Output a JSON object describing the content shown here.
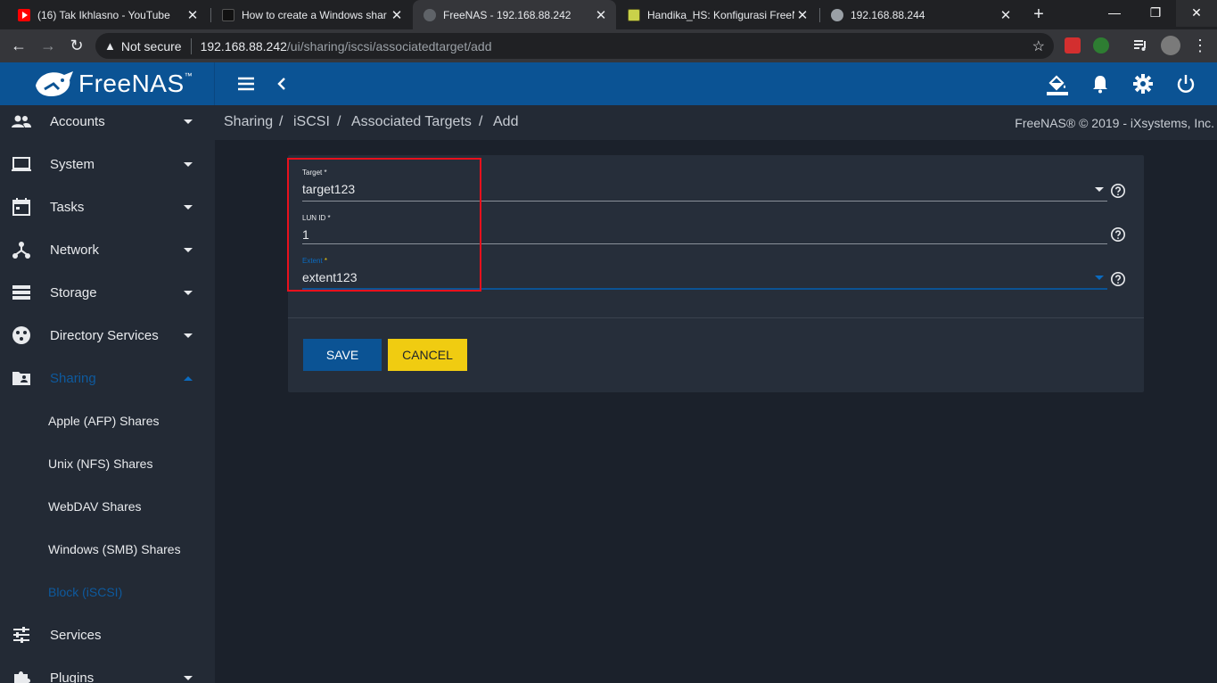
{
  "browser": {
    "tabs": [
      {
        "title": "(16) Tak Ikhlasno - YouTube",
        "favicon": "youtube-icon",
        "color": "#ff0000"
      },
      {
        "title": "How to create a Windows shar",
        "favicon": "video-thumbnail-icon",
        "color": "#111111"
      },
      {
        "title": "FreeNAS - 192.168.88.242",
        "favicon": "freenas-icon",
        "color": "#9aa0a6"
      },
      {
        "title": "Handika_HS: Konfigurasi FreeN",
        "favicon": "blogger-icon",
        "color": "#c9d14a"
      },
      {
        "title": "192.168.88.244",
        "favicon": "globe-icon",
        "color": "#9aa0a6"
      }
    ],
    "security_label": "Not secure",
    "url_host": "192.168.88.242",
    "url_path": "/ui/sharing/iscsi/associatedtarget/add"
  },
  "app": {
    "logo_text": "FreeNAS",
    "logo_tm": "™",
    "brand_color": "#0b5394",
    "copyright": "FreeNAS® © 2019 - iXsystems, Inc."
  },
  "sidebar": {
    "items": [
      {
        "label": "Accounts",
        "icon": "people-icon"
      },
      {
        "label": "System",
        "icon": "laptop-icon"
      },
      {
        "label": "Tasks",
        "icon": "calendar-icon"
      },
      {
        "label": "Network",
        "icon": "network-icon"
      },
      {
        "label": "Storage",
        "icon": "storage-icon"
      },
      {
        "label": "Directory Services",
        "icon": "directory-icon"
      },
      {
        "label": "Sharing",
        "icon": "folder-shared-icon"
      },
      {
        "label": "Services",
        "icon": "tune-icon"
      },
      {
        "label": "Plugins",
        "icon": "puzzle-icon"
      }
    ],
    "sharing_sub": [
      "Apple (AFP) Shares",
      "Unix (NFS) Shares",
      "WebDAV Shares",
      "Windows (SMB) Shares",
      "Block (iSCSI)"
    ]
  },
  "breadcrumb": [
    "Sharing",
    "iSCSI",
    "Associated Targets",
    "Add"
  ],
  "form": {
    "target_label": "Target *",
    "target_value": "target123",
    "lun_label": "LUN ID *",
    "lun_value": "1",
    "extent_label": "Extent",
    "extent_required": " *",
    "extent_value": "extent123",
    "save_label": "SAVE",
    "cancel_label": "CANCEL"
  }
}
